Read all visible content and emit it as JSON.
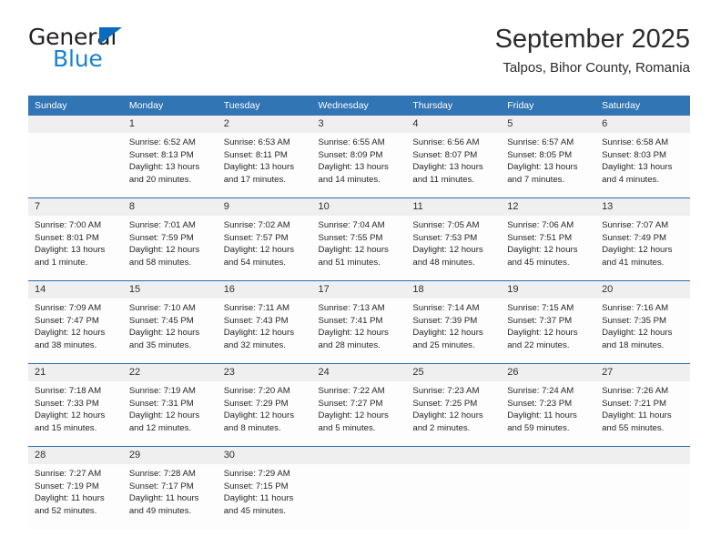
{
  "brand": {
    "word1": "General",
    "word2": "Blue",
    "triangle_color": "#0b6bbf",
    "word2_color": "#1982d1"
  },
  "header": {
    "title": "September 2025",
    "subtitle": "Talpos, Bihor County, Romania"
  },
  "theme": {
    "header_blue": "#3175b4",
    "rule_blue": "#2a6db0",
    "daynum_bg": "#efefef",
    "cell_bg": "#fdfdfd"
  },
  "weekday_headers": [
    "Sunday",
    "Monday",
    "Tuesday",
    "Wednesday",
    "Thursday",
    "Friday",
    "Saturday"
  ],
  "weeks": [
    {
      "days": [
        {
          "num": "",
          "empty": true
        },
        {
          "num": "1",
          "sunrise": "Sunrise: 6:52 AM",
          "sunset": "Sunset: 8:13 PM",
          "daylight1": "Daylight: 13 hours",
          "daylight2": "and 20 minutes."
        },
        {
          "num": "2",
          "sunrise": "Sunrise: 6:53 AM",
          "sunset": "Sunset: 8:11 PM",
          "daylight1": "Daylight: 13 hours",
          "daylight2": "and 17 minutes."
        },
        {
          "num": "3",
          "sunrise": "Sunrise: 6:55 AM",
          "sunset": "Sunset: 8:09 PM",
          "daylight1": "Daylight: 13 hours",
          "daylight2": "and 14 minutes."
        },
        {
          "num": "4",
          "sunrise": "Sunrise: 6:56 AM",
          "sunset": "Sunset: 8:07 PM",
          "daylight1": "Daylight: 13 hours",
          "daylight2": "and 11 minutes."
        },
        {
          "num": "5",
          "sunrise": "Sunrise: 6:57 AM",
          "sunset": "Sunset: 8:05 PM",
          "daylight1": "Daylight: 13 hours",
          "daylight2": "and 7 minutes."
        },
        {
          "num": "6",
          "sunrise": "Sunrise: 6:58 AM",
          "sunset": "Sunset: 8:03 PM",
          "daylight1": "Daylight: 13 hours",
          "daylight2": "and 4 minutes."
        }
      ]
    },
    {
      "days": [
        {
          "num": "7",
          "sunrise": "Sunrise: 7:00 AM",
          "sunset": "Sunset: 8:01 PM",
          "daylight1": "Daylight: 13 hours",
          "daylight2": "and 1 minute."
        },
        {
          "num": "8",
          "sunrise": "Sunrise: 7:01 AM",
          "sunset": "Sunset: 7:59 PM",
          "daylight1": "Daylight: 12 hours",
          "daylight2": "and 58 minutes."
        },
        {
          "num": "9",
          "sunrise": "Sunrise: 7:02 AM",
          "sunset": "Sunset: 7:57 PM",
          "daylight1": "Daylight: 12 hours",
          "daylight2": "and 54 minutes."
        },
        {
          "num": "10",
          "sunrise": "Sunrise: 7:04 AM",
          "sunset": "Sunset: 7:55 PM",
          "daylight1": "Daylight: 12 hours",
          "daylight2": "and 51 minutes."
        },
        {
          "num": "11",
          "sunrise": "Sunrise: 7:05 AM",
          "sunset": "Sunset: 7:53 PM",
          "daylight1": "Daylight: 12 hours",
          "daylight2": "and 48 minutes."
        },
        {
          "num": "12",
          "sunrise": "Sunrise: 7:06 AM",
          "sunset": "Sunset: 7:51 PM",
          "daylight1": "Daylight: 12 hours",
          "daylight2": "and 45 minutes."
        },
        {
          "num": "13",
          "sunrise": "Sunrise: 7:07 AM",
          "sunset": "Sunset: 7:49 PM",
          "daylight1": "Daylight: 12 hours",
          "daylight2": "and 41 minutes."
        }
      ]
    },
    {
      "days": [
        {
          "num": "14",
          "sunrise": "Sunrise: 7:09 AM",
          "sunset": "Sunset: 7:47 PM",
          "daylight1": "Daylight: 12 hours",
          "daylight2": "and 38 minutes."
        },
        {
          "num": "15",
          "sunrise": "Sunrise: 7:10 AM",
          "sunset": "Sunset: 7:45 PM",
          "daylight1": "Daylight: 12 hours",
          "daylight2": "and 35 minutes."
        },
        {
          "num": "16",
          "sunrise": "Sunrise: 7:11 AM",
          "sunset": "Sunset: 7:43 PM",
          "daylight1": "Daylight: 12 hours",
          "daylight2": "and 32 minutes."
        },
        {
          "num": "17",
          "sunrise": "Sunrise: 7:13 AM",
          "sunset": "Sunset: 7:41 PM",
          "daylight1": "Daylight: 12 hours",
          "daylight2": "and 28 minutes."
        },
        {
          "num": "18",
          "sunrise": "Sunrise: 7:14 AM",
          "sunset": "Sunset: 7:39 PM",
          "daylight1": "Daylight: 12 hours",
          "daylight2": "and 25 minutes."
        },
        {
          "num": "19",
          "sunrise": "Sunrise: 7:15 AM",
          "sunset": "Sunset: 7:37 PM",
          "daylight1": "Daylight: 12 hours",
          "daylight2": "and 22 minutes."
        },
        {
          "num": "20",
          "sunrise": "Sunrise: 7:16 AM",
          "sunset": "Sunset: 7:35 PM",
          "daylight1": "Daylight: 12 hours",
          "daylight2": "and 18 minutes."
        }
      ]
    },
    {
      "days": [
        {
          "num": "21",
          "sunrise": "Sunrise: 7:18 AM",
          "sunset": "Sunset: 7:33 PM",
          "daylight1": "Daylight: 12 hours",
          "daylight2": "and 15 minutes."
        },
        {
          "num": "22",
          "sunrise": "Sunrise: 7:19 AM",
          "sunset": "Sunset: 7:31 PM",
          "daylight1": "Daylight: 12 hours",
          "daylight2": "and 12 minutes."
        },
        {
          "num": "23",
          "sunrise": "Sunrise: 7:20 AM",
          "sunset": "Sunset: 7:29 PM",
          "daylight1": "Daylight: 12 hours",
          "daylight2": "and 8 minutes."
        },
        {
          "num": "24",
          "sunrise": "Sunrise: 7:22 AM",
          "sunset": "Sunset: 7:27 PM",
          "daylight1": "Daylight: 12 hours",
          "daylight2": "and 5 minutes."
        },
        {
          "num": "25",
          "sunrise": "Sunrise: 7:23 AM",
          "sunset": "Sunset: 7:25 PM",
          "daylight1": "Daylight: 12 hours",
          "daylight2": "and 2 minutes."
        },
        {
          "num": "26",
          "sunrise": "Sunrise: 7:24 AM",
          "sunset": "Sunset: 7:23 PM",
          "daylight1": "Daylight: 11 hours",
          "daylight2": "and 59 minutes."
        },
        {
          "num": "27",
          "sunrise": "Sunrise: 7:26 AM",
          "sunset": "Sunset: 7:21 PM",
          "daylight1": "Daylight: 11 hours",
          "daylight2": "and 55 minutes."
        }
      ]
    },
    {
      "days": [
        {
          "num": "28",
          "sunrise": "Sunrise: 7:27 AM",
          "sunset": "Sunset: 7:19 PM",
          "daylight1": "Daylight: 11 hours",
          "daylight2": "and 52 minutes."
        },
        {
          "num": "29",
          "sunrise": "Sunrise: 7:28 AM",
          "sunset": "Sunset: 7:17 PM",
          "daylight1": "Daylight: 11 hours",
          "daylight2": "and 49 minutes."
        },
        {
          "num": "30",
          "sunrise": "Sunrise: 7:29 AM",
          "sunset": "Sunset: 7:15 PM",
          "daylight1": "Daylight: 11 hours",
          "daylight2": "and 45 minutes."
        },
        {
          "num": "",
          "empty": true
        },
        {
          "num": "",
          "empty": true
        },
        {
          "num": "",
          "empty": true
        },
        {
          "num": "",
          "empty": true
        }
      ]
    }
  ]
}
